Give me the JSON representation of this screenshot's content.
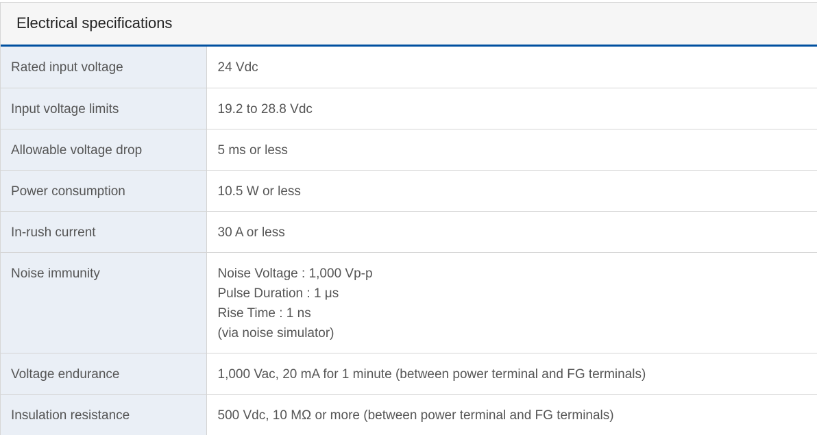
{
  "panel": {
    "title": "Electrical specifications"
  },
  "rows": [
    {
      "label": "Rated input voltage",
      "value": "24 Vdc"
    },
    {
      "label": "Input voltage limits",
      "value": "19.2 to 28.8 Vdc"
    },
    {
      "label": "Allowable voltage drop",
      "value": "5 ms or less"
    },
    {
      "label": "Power consumption",
      "value": "10.5 W or less"
    },
    {
      "label": "In-rush current",
      "value": "30 A or less"
    },
    {
      "label": "Noise immunity",
      "lines": [
        "Noise Voltage : 1,000 Vp-p",
        "Pulse Duration : 1 μs",
        "Rise Time : 1 ns",
        "(via noise simulator)"
      ]
    },
    {
      "label": "Voltage endurance",
      "value": "1,000 Vac, 20 mA for 1 minute (between power terminal and FG terminals)"
    },
    {
      "label": "Insulation resistance",
      "value": "500 Vdc, 10 MΩ or more (between power terminal and FG terminals)"
    }
  ],
  "colors": {
    "header_accent": "#0050a0",
    "label_bg": "#eaeff6",
    "header_bg": "#f6f6f6"
  }
}
